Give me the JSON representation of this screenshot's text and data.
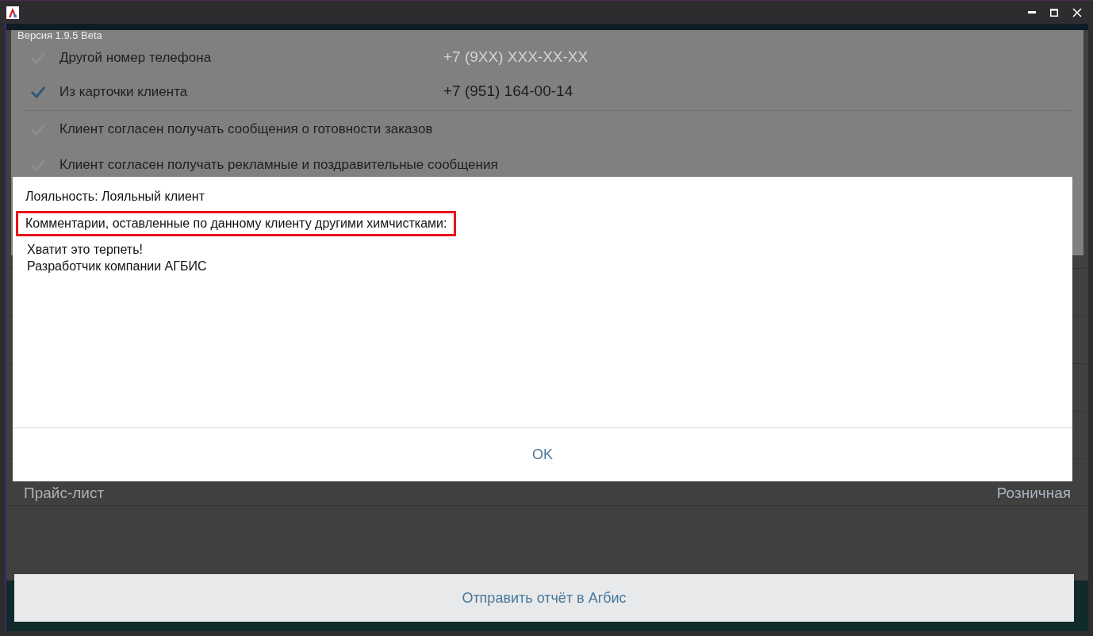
{
  "version": "Версия 1.9.5 Beta",
  "phone_options": [
    {
      "label": "Другой номер телефона",
      "checked": false,
      "placeholder": "+7 (9XX) XXX-XX-XX"
    },
    {
      "label": "Из карточки клиента",
      "checked": true,
      "value": "+7 (951) 164-00-14"
    }
  ],
  "consents": [
    {
      "label": "Клиент согласен получать сообщения о готовности заказов",
      "checked": false
    },
    {
      "label": "Клиент согласен получать рекламные и поздравительные сообщения",
      "checked": false
    }
  ],
  "price_list": {
    "label": "Прайс-лист",
    "value": "Розничная"
  },
  "dialog": {
    "loyalty": "Лояльность: Лояльный клиент",
    "comments_heading": "Комментарии, оставленные по данному клиенту другими химчистками:",
    "comments": [
      "Хватит это терпеть!",
      "Разработчик компании АГБИС"
    ],
    "ok": "OK"
  },
  "report_button": "Отправить отчёт в Агбис"
}
